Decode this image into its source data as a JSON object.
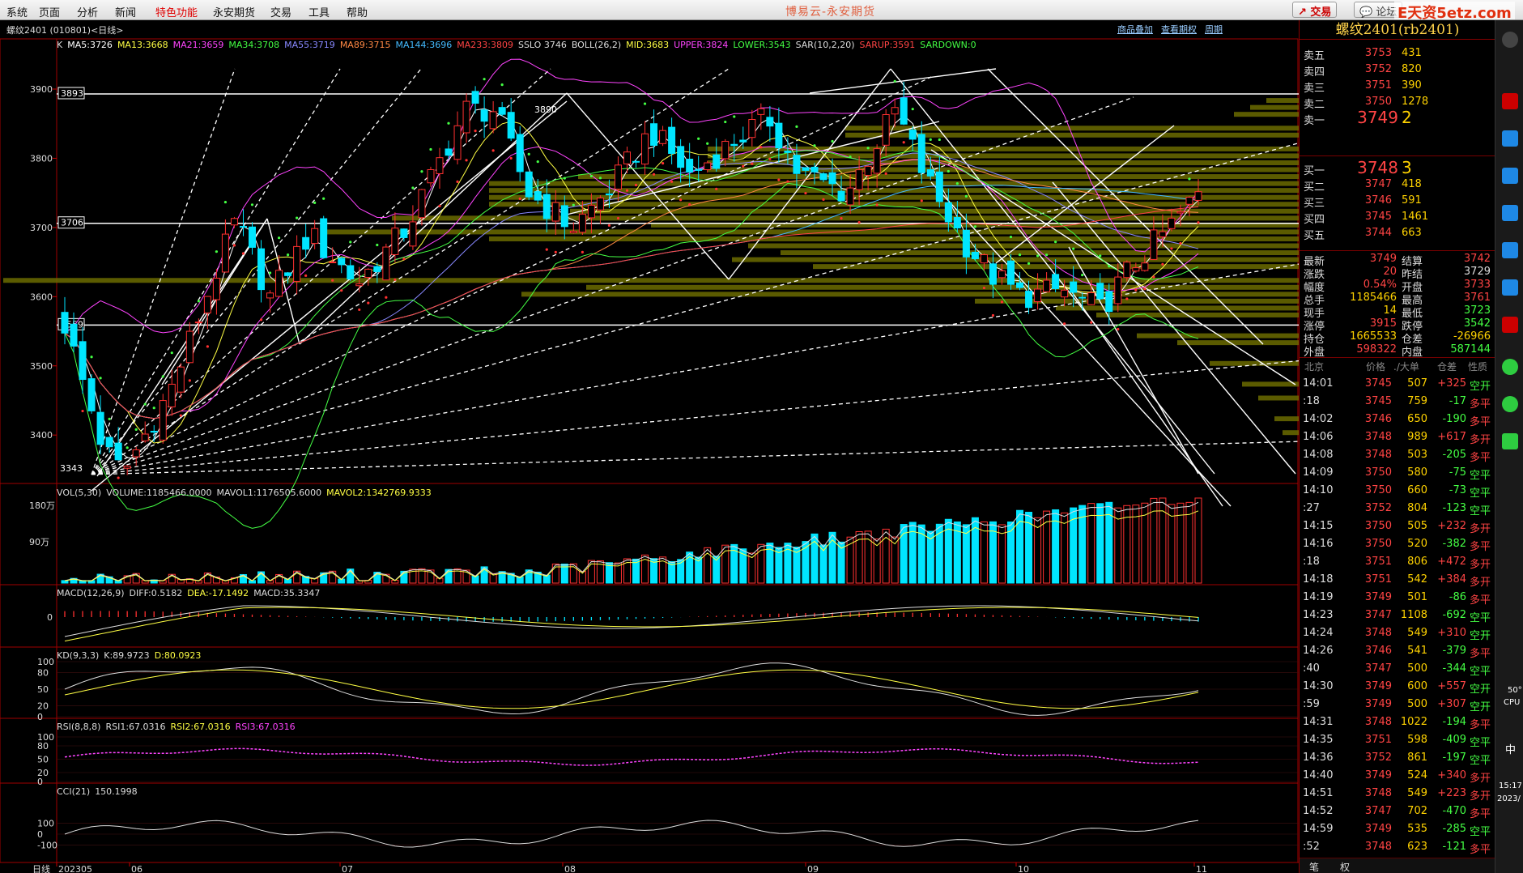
{
  "menu": {
    "items": [
      "系统",
      "页面",
      "分析",
      "新闻",
      "特色功能",
      "永安期货",
      "交易",
      "工具",
      "帮助"
    ],
    "hot_index": 4
  },
  "app_title": "博易云-永安期货",
  "top_buttons": {
    "trade": "交易",
    "forum": "论坛"
  },
  "watermark": "E天资5etz.com",
  "chart": {
    "panel_title": "螺纹2401 (010801)<日线>",
    "links": [
      "商品叠加",
      "查看期权",
      "周期"
    ],
    "indicator_ma": [
      {
        "text": "K",
        "color": "#dddddd"
      },
      {
        "text": "MA5:3726",
        "color": "#ffffff"
      },
      {
        "text": "MA13:3668",
        "color": "#ffff44"
      },
      {
        "text": "MA21:3659",
        "color": "#ff44ff"
      },
      {
        "text": "MA34:3708",
        "color": "#44ff44"
      },
      {
        "text": "MA55:3719",
        "color": "#8888ff"
      },
      {
        "text": "MA89:3715",
        "color": "#ff8844"
      },
      {
        "text": "MA144:3696",
        "color": "#44bbff"
      },
      {
        "text": "MA233:3809",
        "color": "#ff4444"
      },
      {
        "text": "SSLO 3746",
        "color": "#dddddd"
      },
      {
        "text": "BOLL(26,2)",
        "color": "#dddddd"
      },
      {
        "text": "MID:3683",
        "color": "#ffff44"
      },
      {
        "text": "UPPER:3824",
        "color": "#ff44ff"
      },
      {
        "text": "LOWER:3543",
        "color": "#44ff44"
      },
      {
        "text": "SAR(10,2,20)",
        "color": "#dddddd"
      },
      {
        "text": "SARUP:3591",
        "color": "#ff4444"
      },
      {
        "text": "SARDOWN:0",
        "color": "#44ff44"
      }
    ],
    "price_axis": [
      "3900",
      "3800",
      "3700",
      "3600",
      "3500",
      "3400"
    ],
    "price_range": [
      3330,
      3955
    ],
    "marked_prices": [
      {
        "label": "3893",
        "value": 3893
      },
      {
        "label": "3706",
        "value": 3706
      },
      {
        "label": "3559",
        "value": 3559
      }
    ],
    "peak_label": "3890",
    "low_label": "3343",
    "vol_line": [
      {
        "text": "VOL(5,30)",
        "color": "#dddddd"
      },
      {
        "text": "VOLUME:1185466.0000",
        "color": "#dddddd"
      },
      {
        "text": "MAVOL1:1176505.6000",
        "color": "#dddddd"
      },
      {
        "text": "MAVOL2:1342769.9333",
        "color": "#ffff44"
      }
    ],
    "vol_axis": [
      "180万",
      "90万"
    ],
    "macd_line": [
      {
        "text": "MACD(12,26,9)",
        "color": "#dddddd"
      },
      {
        "text": "DIFF:0.5182",
        "color": "#dddddd"
      },
      {
        "text": "DEA:-17.1492",
        "color": "#ffff44"
      },
      {
        "text": "MACD:35.3347",
        "color": "#dddddd"
      }
    ],
    "macd_axis": [
      "0"
    ],
    "kd_line": [
      {
        "text": "KD(9,3,3)",
        "color": "#dddddd"
      },
      {
        "text": "K:89.9723",
        "color": "#dddddd"
      },
      {
        "text": "D:80.0923",
        "color": "#ffff44"
      }
    ],
    "kd_axis": [
      "100",
      "80",
      "50",
      "20",
      "0"
    ],
    "rsi_line": [
      {
        "text": "RSI(8,8,8)",
        "color": "#dddddd"
      },
      {
        "text": "RSI1:67.0316",
        "color": "#dddddd"
      },
      {
        "text": "RSI2:67.0316",
        "color": "#ffff44"
      },
      {
        "text": "RSI3:67.0316",
        "color": "#ff44ff"
      }
    ],
    "rsi_axis": [
      "100",
      "80",
      "50",
      "20",
      "0"
    ],
    "cci_line": [
      {
        "text": "CCI(21)",
        "color": "#dddddd"
      },
      {
        "text": "150.1998",
        "color": "#dddddd"
      }
    ],
    "cci_axis": [
      "100",
      "0",
      "-100"
    ],
    "date_axis": {
      "prefix": "日线",
      "labels": [
        "202305",
        "06",
        "07",
        "08",
        "09",
        "10",
        "11"
      ]
    }
  },
  "quote": {
    "title": "螺纹2401(rb2401)",
    "asks": [
      {
        "label": "卖五",
        "price": "3753",
        "vol": "431"
      },
      {
        "label": "卖四",
        "price": "3752",
        "vol": "820"
      },
      {
        "label": "卖三",
        "price": "3751",
        "vol": "390"
      },
      {
        "label": "卖二",
        "price": "3750",
        "vol": "1278"
      },
      {
        "label": "卖一",
        "price": "3749",
        "vol": "2"
      }
    ],
    "bids": [
      {
        "label": "买一",
        "price": "3748",
        "vol": "3"
      },
      {
        "label": "买二",
        "price": "3747",
        "vol": "418"
      },
      {
        "label": "买三",
        "price": "3746",
        "vol": "591"
      },
      {
        "label": "买四",
        "price": "3745",
        "vol": "1461"
      },
      {
        "label": "买五",
        "price": "3744",
        "vol": "663"
      }
    ],
    "stats": [
      {
        "l1": "最新",
        "v1": "3749",
        "c1": "#ff4444",
        "l2": "结算",
        "v2": "3742",
        "c2": "#ff4444"
      },
      {
        "l1": "涨跌",
        "v1": "20",
        "c1": "#ff4444",
        "l2": "昨结",
        "v2": "3729",
        "c2": "#dddddd"
      },
      {
        "l1": "幅度",
        "v1": "0.54%",
        "c1": "#ff4444",
        "l2": "开盘",
        "v2": "3733",
        "c2": "#ff4444"
      },
      {
        "l1": "总手",
        "v1": "1185466",
        "c1": "#ffd200",
        "l2": "最高",
        "v2": "3761",
        "c2": "#ff4444"
      },
      {
        "l1": "现手",
        "v1": "14",
        "c1": "#ffd200",
        "l2": "最低",
        "v2": "3723",
        "c2": "#44ff44"
      },
      {
        "l1": "涨停",
        "v1": "3915",
        "c1": "#ff4444",
        "l2": "跌停",
        "v2": "3542",
        "c2": "#44ff44"
      },
      {
        "l1": "持仓",
        "v1": "1665533",
        "c1": "#ffd200",
        "l2": "仓差",
        "v2": "-26966",
        "c2": "#ffd200"
      },
      {
        "l1": "外盘",
        "v1": "598322",
        "c1": "#ff4444",
        "l2": "内盘",
        "v2": "587144",
        "c2": "#44ff44"
      }
    ],
    "tick_header": [
      "北京",
      "价格",
      "./大单",
      "仓差",
      "性质"
    ],
    "ticks": [
      {
        "time": "14:01",
        "price": "3745",
        "vol": "507",
        "chg": "+325",
        "nat": "空开",
        "nc": "#44ff44"
      },
      {
        "time": ":18",
        "price": "3745",
        "vol": "759",
        "chg": "-17",
        "nat": "多平",
        "nc": "#ff4444"
      },
      {
        "time": "14:02",
        "price": "3746",
        "vol": "650",
        "chg": "-190",
        "nat": "多平",
        "nc": "#ff4444"
      },
      {
        "time": "14:06",
        "price": "3748",
        "vol": "989",
        "chg": "+617",
        "nat": "多开",
        "nc": "#ff4444"
      },
      {
        "time": "14:08",
        "price": "3748",
        "vol": "503",
        "chg": "-205",
        "nat": "多平",
        "nc": "#ff4444"
      },
      {
        "time": "14:09",
        "price": "3750",
        "vol": "580",
        "chg": "-75",
        "nat": "空平",
        "nc": "#44ff44"
      },
      {
        "time": "14:10",
        "price": "3750",
        "vol": "660",
        "chg": "-73",
        "nat": "空平",
        "nc": "#44ff44"
      },
      {
        "time": ":27",
        "price": "3752",
        "vol": "804",
        "chg": "-123",
        "nat": "空平",
        "nc": "#44ff44"
      },
      {
        "time": "14:15",
        "price": "3750",
        "vol": "505",
        "chg": "+232",
        "nat": "多开",
        "nc": "#ff4444"
      },
      {
        "time": "14:16",
        "price": "3750",
        "vol": "520",
        "chg": "-382",
        "nat": "多平",
        "nc": "#ff4444"
      },
      {
        "time": ":18",
        "price": "3751",
        "vol": "806",
        "chg": "+472",
        "nat": "多开",
        "nc": "#ff4444"
      },
      {
        "time": "14:18",
        "price": "3751",
        "vol": "542",
        "chg": "+384",
        "nat": "多开",
        "nc": "#ff4444"
      },
      {
        "time": "14:19",
        "price": "3749",
        "vol": "501",
        "chg": "-86",
        "nat": "多平",
        "nc": "#ff4444"
      },
      {
        "time": "14:23",
        "price": "3747",
        "vol": "1108",
        "chg": "-692",
        "nat": "空平",
        "nc": "#44ff44"
      },
      {
        "time": "14:24",
        "price": "3748",
        "vol": "549",
        "chg": "+310",
        "nat": "空开",
        "nc": "#44ff44"
      },
      {
        "time": "14:26",
        "price": "3746",
        "vol": "541",
        "chg": "-379",
        "nat": "多平",
        "nc": "#ff4444"
      },
      {
        "time": ":40",
        "price": "3747",
        "vol": "500",
        "chg": "-344",
        "nat": "空平",
        "nc": "#44ff44"
      },
      {
        "time": "14:30",
        "price": "3749",
        "vol": "600",
        "chg": "+557",
        "nat": "空开",
        "nc": "#44ff44"
      },
      {
        "time": ":59",
        "price": "3749",
        "vol": "500",
        "chg": "+307",
        "nat": "空开",
        "nc": "#44ff44"
      },
      {
        "time": "14:31",
        "price": "3748",
        "vol": "1022",
        "chg": "-194",
        "nat": "多平",
        "nc": "#ff4444"
      },
      {
        "time": "14:35",
        "price": "3751",
        "vol": "598",
        "chg": "-409",
        "nat": "空平",
        "nc": "#44ff44"
      },
      {
        "time": "14:36",
        "price": "3752",
        "vol": "861",
        "chg": "-197",
        "nat": "空平",
        "nc": "#44ff44"
      },
      {
        "time": "14:40",
        "price": "3749",
        "vol": "524",
        "chg": "+340",
        "nat": "多开",
        "nc": "#ff4444"
      },
      {
        "time": "14:51",
        "price": "3748",
        "vol": "549",
        "chg": "+223",
        "nat": "多开",
        "nc": "#ff4444"
      },
      {
        "time": "14:52",
        "price": "3747",
        "vol": "702",
        "chg": "-470",
        "nat": "多平",
        "nc": "#ff4444"
      },
      {
        "time": "14:59",
        "price": "3749",
        "vol": "535",
        "chg": "-285",
        "nat": "空平",
        "nc": "#44ff44"
      },
      {
        "time": ":52",
        "price": "3748",
        "vol": "623",
        "chg": "-121",
        "nat": "多平",
        "nc": "#ff4444"
      }
    ],
    "tabs": [
      "笔",
      "权"
    ]
  },
  "taskbar": {
    "percent": "50°",
    "cpu": "CPU",
    "lang": "中",
    "time": "15:17",
    "date": "2023/"
  }
}
